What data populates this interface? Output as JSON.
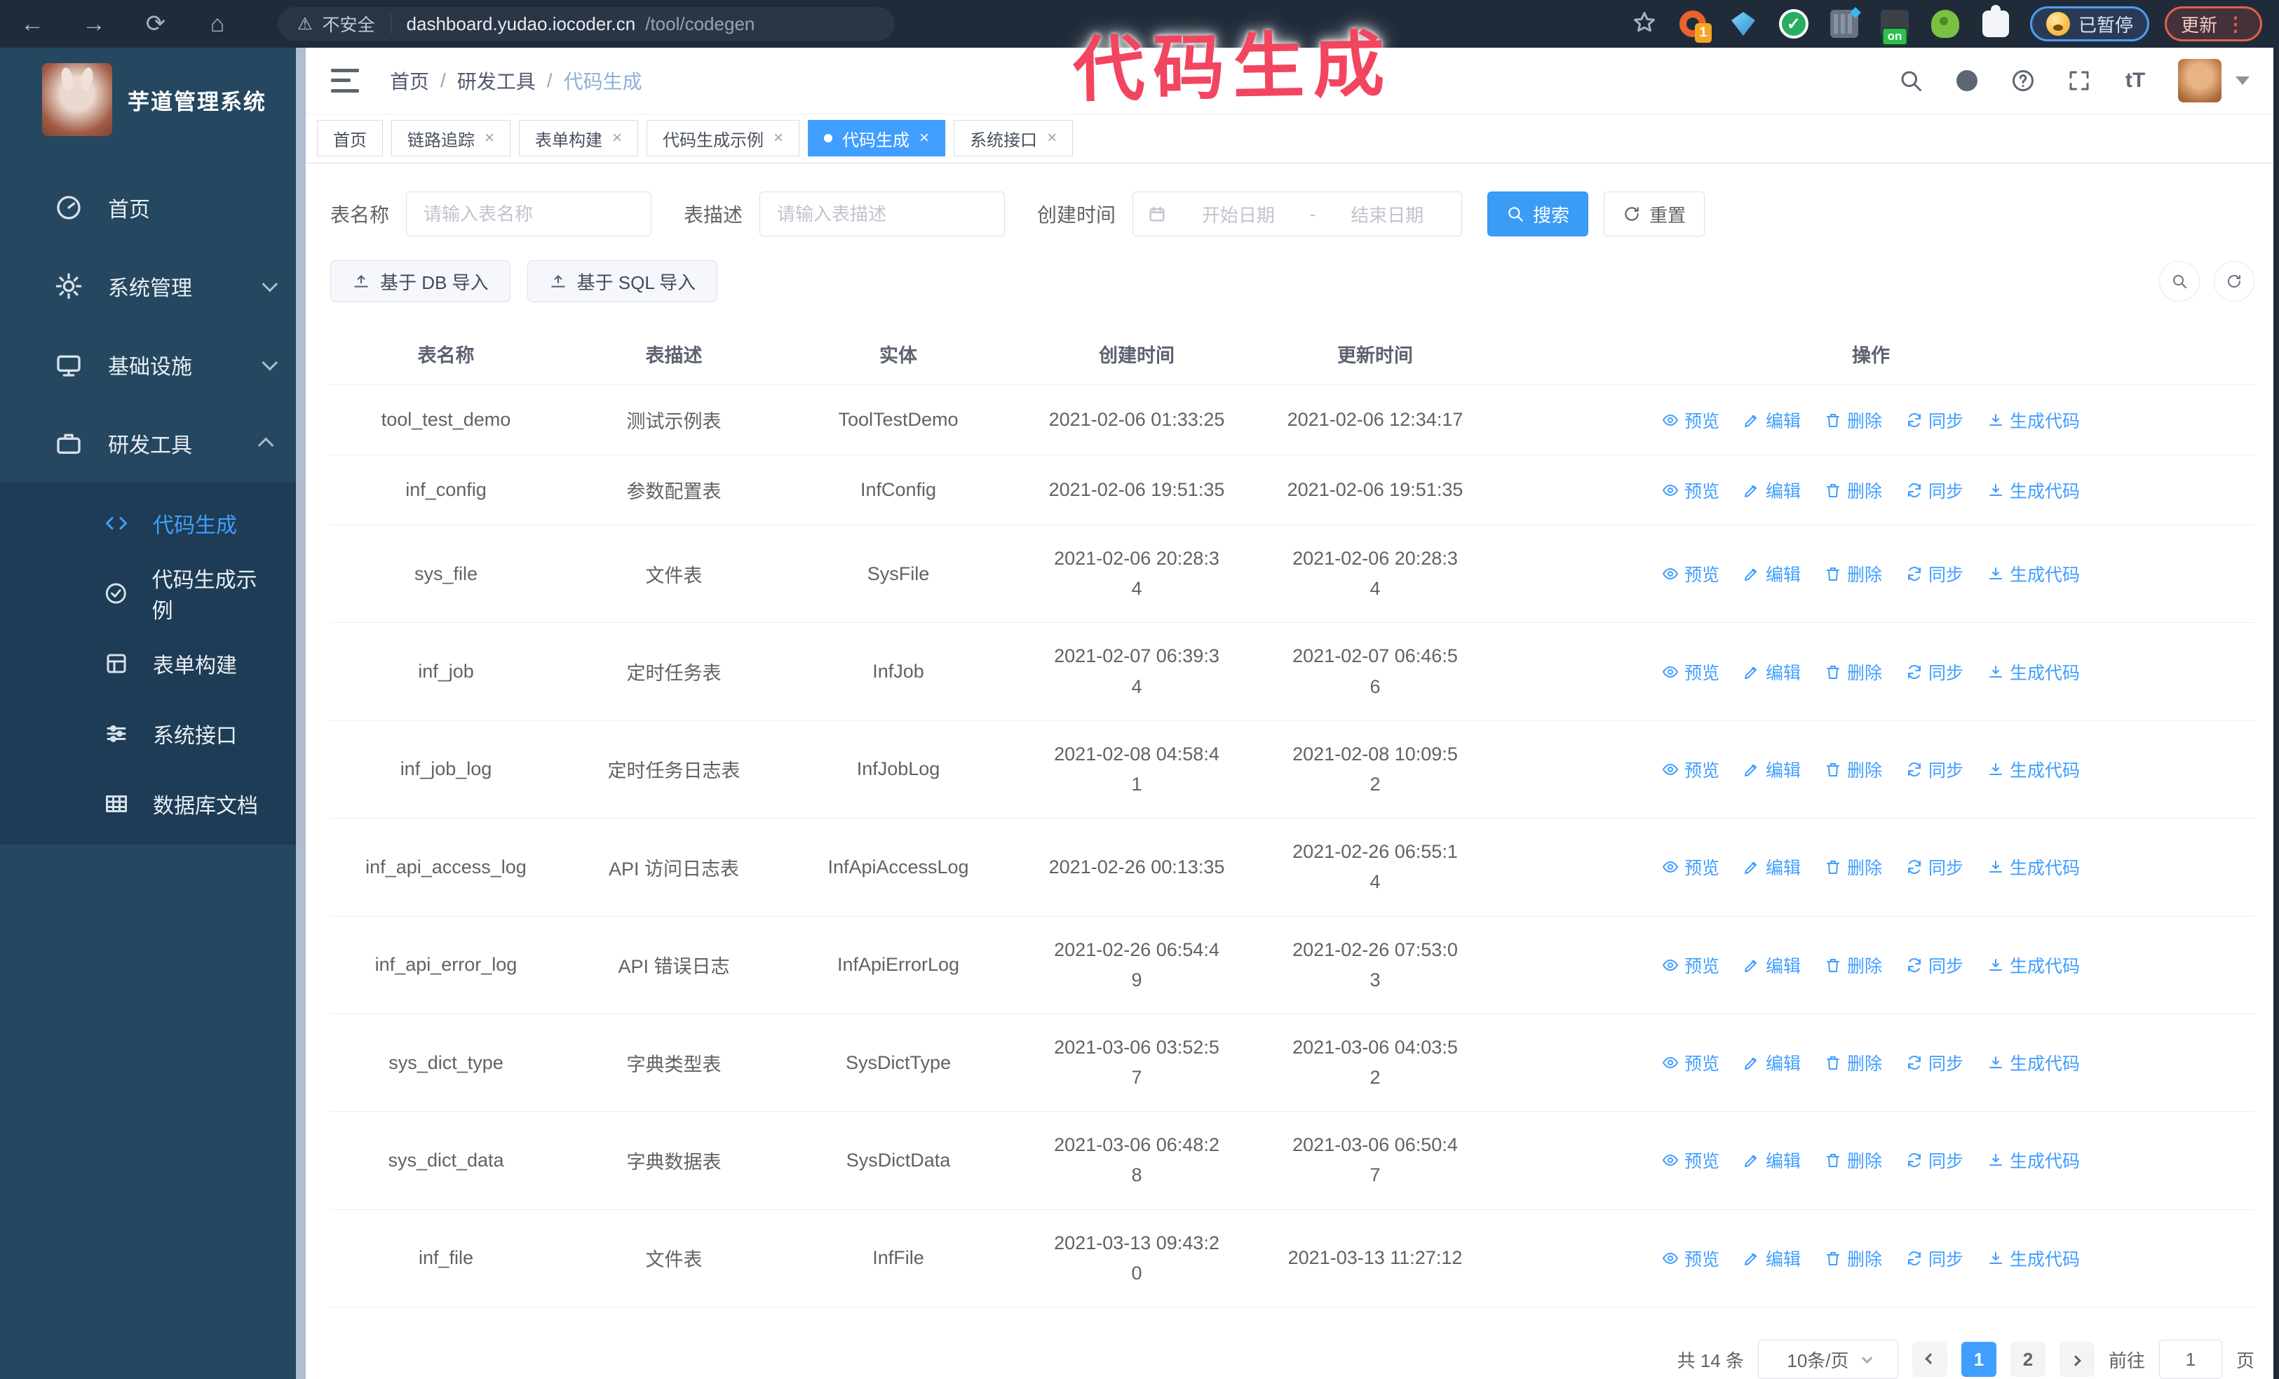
{
  "watermark": {
    "text": "代码生成",
    "color": "#F2455F"
  },
  "browser": {
    "security_label": "不安全",
    "url_host": "dashboard.yudao.iocoder.cn",
    "url_path": "/tool/codegen",
    "extension_badge": "1",
    "extension_on_badge": "on",
    "paused_label": "已暂停",
    "update_label": "更新"
  },
  "icons": {
    "warning": "⚠",
    "back": "←",
    "forward": "→",
    "refresh": "⟳",
    "home": "⌂",
    "more_vertical": "⋮",
    "close": "×",
    "text_size": "tT",
    "check": "✓",
    "names": [
      "back-icon",
      "forward-icon",
      "refresh-icon",
      "home-icon",
      "warning-icon",
      "star-icon",
      "search-icon",
      "github-icon",
      "question-icon",
      "fullscreen-icon",
      "text-size-icon",
      "caret-down-icon",
      "hamburger-icon",
      "calendar-icon",
      "eye-icon",
      "pen-icon",
      "trash-icon",
      "sync-icon",
      "download-icon",
      "upload-icon",
      "gear-icon",
      "dashboard-icon",
      "monitor-icon",
      "briefcase-icon",
      "code-icon",
      "badge-check-icon",
      "form-icon",
      "sliders-icon",
      "db-table-icon"
    ]
  },
  "sidebar": {
    "app_title": "芋道管理系统",
    "items": [
      {
        "label": "首页"
      },
      {
        "label": "系统管理"
      },
      {
        "label": "基础设施"
      },
      {
        "label": "研发工具"
      }
    ],
    "subitems": [
      {
        "label": "代码生成",
        "active": true
      },
      {
        "label": "代码生成示例"
      },
      {
        "label": "表单构建"
      },
      {
        "label": "系统接口"
      },
      {
        "label": "数据库文档"
      }
    ]
  },
  "header": {
    "breadcrumb": [
      "首页",
      "研发工具",
      "代码生成"
    ],
    "separator": "/"
  },
  "tabs": [
    {
      "label": "首页"
    },
    {
      "label": "链路追踪"
    },
    {
      "label": "表单构建"
    },
    {
      "label": "代码生成示例"
    },
    {
      "label": "代码生成"
    },
    {
      "label": "系统接口"
    }
  ],
  "filters": {
    "table_name_label": "表名称",
    "table_name_placeholder": "请输入表名称",
    "table_desc_label": "表描述",
    "table_desc_placeholder": "请输入表描述",
    "create_time_label": "创建时间",
    "start_placeholder": "开始日期",
    "range_separator": "-",
    "end_placeholder": "结束日期",
    "search_label": "搜索",
    "reset_label": "重置"
  },
  "toolbar": {
    "import_db_label": "基于 DB 导入",
    "import_sql_label": "基于 SQL 导入"
  },
  "table": {
    "columns": [
      "表名称",
      "表描述",
      "实体",
      "创建时间",
      "更新时间",
      "操作"
    ],
    "actions": [
      "预览",
      "编辑",
      "删除",
      "同步",
      "生成代码"
    ],
    "rows": [
      {
        "name": "tool_test_demo",
        "desc": "测试示例表",
        "entity": "ToolTestDemo",
        "created": "2021-02-06 01:33:25",
        "updated": "2021-02-06 12:34:17"
      },
      {
        "name": "inf_config",
        "desc": "参数配置表",
        "entity": "InfConfig",
        "created": "2021-02-06 19:51:35",
        "updated": "2021-02-06 19:51:35"
      },
      {
        "name": "sys_file",
        "desc": "文件表",
        "entity": "SysFile",
        "created": "2021-02-06 20:28:3\n4",
        "updated": "2021-02-06 20:28:3\n4"
      },
      {
        "name": "inf_job",
        "desc": "定时任务表",
        "entity": "InfJob",
        "created": "2021-02-07 06:39:3\n4",
        "updated": "2021-02-07 06:46:5\n6"
      },
      {
        "name": "inf_job_log",
        "desc": "定时任务日志表",
        "entity": "InfJobLog",
        "created": "2021-02-08 04:58:4\n1",
        "updated": "2021-02-08 10:09:5\n2"
      },
      {
        "name": "inf_api_access_log",
        "desc": "API 访问日志表",
        "entity": "InfApiAccessLog",
        "created": "2021-02-26 00:13:35",
        "updated": "2021-02-26 06:55:1\n4"
      },
      {
        "name": "inf_api_error_log",
        "desc": "API 错误日志",
        "entity": "InfApiErrorLog",
        "created": "2021-02-26 06:54:4\n9",
        "updated": "2021-02-26 07:53:0\n3"
      },
      {
        "name": "sys_dict_type",
        "desc": "字典类型表",
        "entity": "SysDictType",
        "created": "2021-03-06 03:52:5\n7",
        "updated": "2021-03-06 04:03:5\n2"
      },
      {
        "name": "sys_dict_data",
        "desc": "字典数据表",
        "entity": "SysDictData",
        "created": "2021-03-06 06:48:2\n8",
        "updated": "2021-03-06 06:50:4\n7"
      },
      {
        "name": "inf_file",
        "desc": "文件表",
        "entity": "InfFile",
        "created": "2021-03-13 09:43:2\n0",
        "updated": "2021-03-13 11:27:12"
      }
    ]
  },
  "pagination": {
    "total_label": "共 14 条",
    "page_size_label": "10条/页",
    "pages": [
      "1",
      "2"
    ],
    "active_page": "1",
    "goto_label": "前往",
    "goto_value": "1",
    "page_unit_label": "页"
  },
  "colors": {
    "primary": "#409EFF",
    "watermark_pink": "#F2455F",
    "sidebar_bg": "#25475F",
    "submenu_bg": "#1E3C55",
    "chrome_bg": "#202B3A"
  }
}
